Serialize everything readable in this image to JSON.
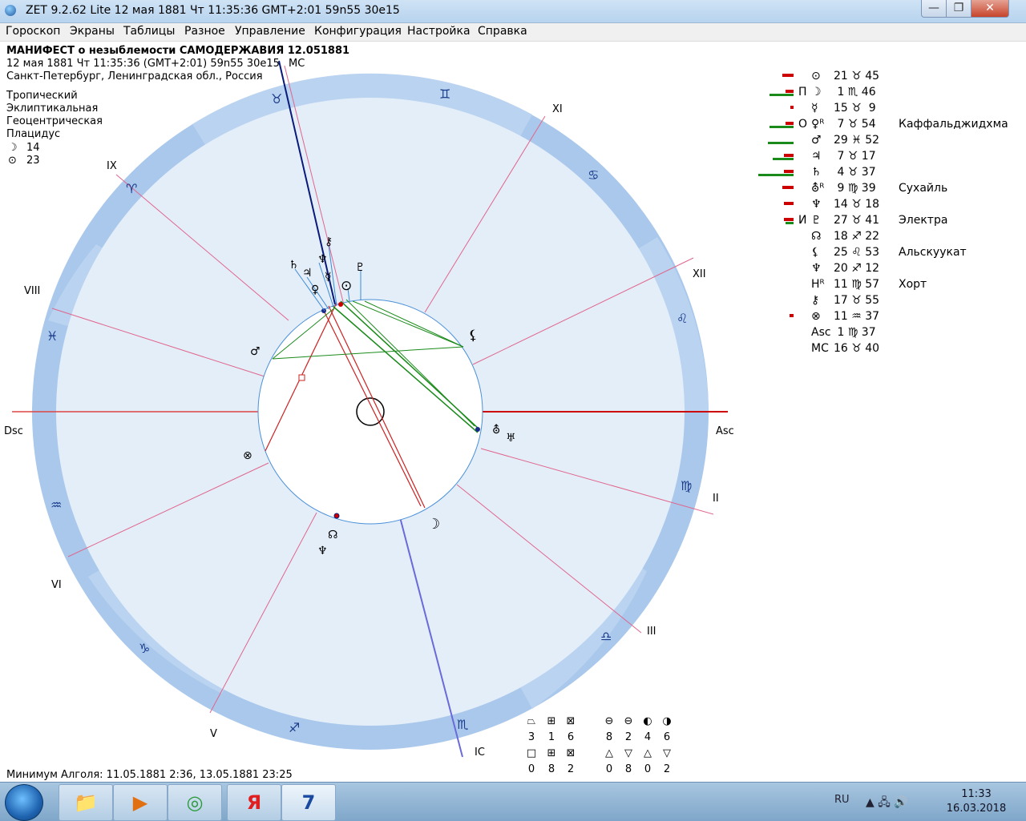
{
  "title_bar": {
    "title": "ZET 9.2.62 Lite    12 мая 1881   Чт   11:35:36 GMT+2:01  59n55  30e15",
    "min": "—",
    "max": "❐",
    "close": "✕"
  },
  "menu": [
    "Гороскоп",
    "Экраны",
    "Таблицы",
    "Разное",
    "Управление",
    "Конфигурация",
    "Настройка",
    "Справка"
  ],
  "header": {
    "title": "МАНИФЕСТ о незыблемости САМОДЕРЖАВИЯ 12.051881",
    "datetime": "12 мая 1881  Чт  11:35:36 (GMT+2:01) 59n55  30e15",
    "place": "Санкт-Петербург, Ленинградская обл., Россия"
  },
  "settings": [
    "Тропический",
    "Эклиптикальная",
    "Геоцентрическая",
    "Плацидус"
  ],
  "phases": [
    {
      "glyph": "☽",
      "value": "14"
    },
    {
      "glyph": "⊙",
      "value": "23"
    }
  ],
  "houses": {
    "mc": "MC",
    "ic": "IC",
    "asc": "Asc",
    "dsc": "Dsc",
    "ii": "II",
    "iii": "III",
    "v": "V",
    "vi": "VI",
    "viii": "VIII",
    "ix": "IX",
    "xi": "XI",
    "xii": "XII"
  },
  "zodiac": [
    "♉",
    "♊",
    "♋",
    "♌",
    "♍",
    "♎",
    "♏",
    "♐",
    "♑",
    "♒",
    "♓",
    "♈"
  ],
  "chart_glyphs": [
    "⚷",
    "♄",
    "♃",
    "♆",
    "♀",
    "☿",
    "♇",
    "⊙",
    "♂",
    "⚸",
    "⛢",
    "♅",
    "⊗",
    "☊",
    "♆",
    "☽"
  ],
  "planets": [
    {
      "pre": "",
      "glyph": "⊙",
      "pos": "21 ♉ 45",
      "name": "",
      "red": 14,
      "green": 0
    },
    {
      "pre": "П",
      "glyph": "☽",
      "pos": " 1 ♏ 46",
      "name": "",
      "red": 10,
      "green": 30
    },
    {
      "pre": "",
      "glyph": "☿",
      "pos": "15 ♉  9",
      "name": "",
      "red": 4,
      "green": 0
    },
    {
      "pre": "О",
      "glyph": "♀ᴿ",
      "pos": " 7 ♉ 54",
      "name": "Каффальджидхма",
      "red": 10,
      "green": 30
    },
    {
      "pre": "",
      "glyph": "♂",
      "pos": "29 ♓ 52",
      "name": "",
      "red": 0,
      "green": 32
    },
    {
      "pre": "",
      "glyph": "♃",
      "pos": " 7 ♉ 17",
      "name": "",
      "red": 12,
      "green": 26
    },
    {
      "pre": "",
      "glyph": "♄",
      "pos": " 4 ♉ 37",
      "name": "",
      "red": 12,
      "green": 44
    },
    {
      "pre": "",
      "glyph": "⛢ᴿ",
      "pos": " 9 ♍ 39",
      "name": "Сухайль",
      "red": 14,
      "green": 0
    },
    {
      "pre": "",
      "glyph": "♆",
      "pos": "14 ♉ 18",
      "name": "",
      "red": 12,
      "green": 0
    },
    {
      "pre": "И",
      "glyph": "♇",
      "pos": "27 ♉ 41",
      "name": "Электра",
      "red": 12,
      "green": 10
    },
    {
      "pre": "",
      "glyph": "☊",
      "pos": "18 ♐ 22",
      "name": "",
      "red": 0,
      "green": 0
    },
    {
      "pre": "",
      "glyph": "⚸",
      "pos": "25 ♌ 53",
      "name": "Альскуукат",
      "red": 0,
      "green": 0
    },
    {
      "pre": "",
      "glyph": "♆",
      "pos": "20 ♐ 12",
      "name": "",
      "red": 0,
      "green": 0
    },
    {
      "pre": "",
      "glyph": "Hᴿ",
      "pos": "11 ♍ 57",
      "name": "Хорт",
      "red": 0,
      "green": 0
    },
    {
      "pre": "",
      "glyph": "⚷",
      "pos": "17 ♉ 55",
      "name": "",
      "red": 0,
      "green": 0
    },
    {
      "pre": "",
      "glyph": "⊗",
      "pos": "11 ♒ 37",
      "name": "",
      "red": 5,
      "green": 0
    },
    {
      "pre": "",
      "glyph": "Asc",
      "pos": " 1 ♍ 37",
      "name": "",
      "red": 0,
      "green": 0
    },
    {
      "pre": "",
      "glyph": "MC",
      "pos": "16 ♉ 40",
      "name": "",
      "red": 0,
      "green": 0
    }
  ],
  "aspect_stats": {
    "top_icons": [
      "⏢",
      "⊞",
      "⊠",
      "⊖",
      "⊖",
      "◐",
      "◑"
    ],
    "top_values": [
      "3",
      "1",
      "6",
      "8",
      "2",
      "4",
      "6"
    ],
    "bottom_icons": [
      "□",
      "⊞",
      "⊠",
      "△",
      "▽",
      "△",
      "▽"
    ],
    "bottom_values": [
      "0",
      "8",
      "2",
      "0",
      "8",
      "0",
      "2"
    ]
  },
  "footer": {
    "algol": "Минимум Алголя: 11.05.1881  2:36,  13.05.1881 23:25"
  },
  "taskbar": {
    "items": [
      "📁",
      "▶",
      "◎",
      "Я",
      "7"
    ],
    "lang": "RU",
    "tray": "▲  🖧  🔊",
    "time": "11:33",
    "date": "16.03.2018"
  },
  "colors": {
    "ring": "#a9c8ec",
    "ring_alt": "#c4dbf5",
    "inner": "#e4eef9",
    "red": "#cc0000",
    "green": "#1a8a1a",
    "blue": "#1a2a8a"
  }
}
